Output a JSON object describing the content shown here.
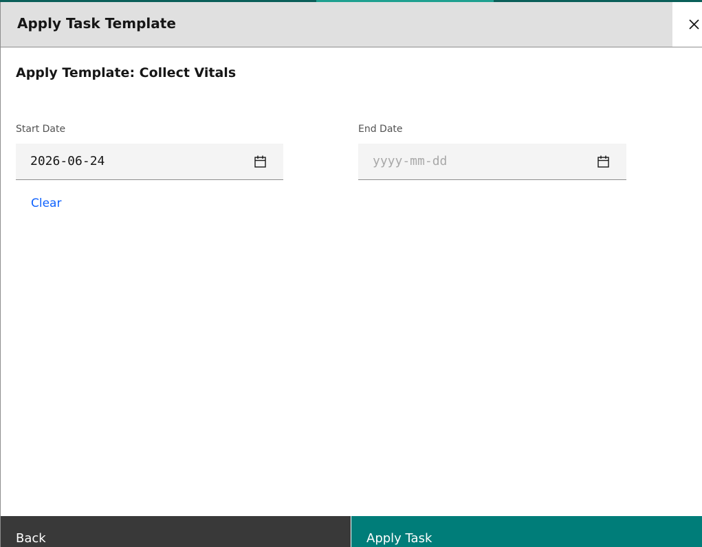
{
  "modal": {
    "title": "Apply Task Template",
    "close_icon": "close-icon"
  },
  "section": {
    "title": "Apply Template: Collect Vitals"
  },
  "start_date": {
    "label": "Start Date",
    "value": "2026-06-24",
    "icon": "calendar-icon"
  },
  "end_date": {
    "label": "End Date",
    "value": "",
    "placeholder": "yyyy-mm-dd",
    "icon": "calendar-icon"
  },
  "clear_link": "Clear",
  "footer": {
    "back_label": "Back",
    "apply_label": "Apply Task"
  },
  "colors": {
    "accent": "#007d79",
    "link": "#0f62fe",
    "secondary_button": "#393939",
    "header_bg": "#e0e0e0",
    "field_bg": "#f4f4f4"
  }
}
